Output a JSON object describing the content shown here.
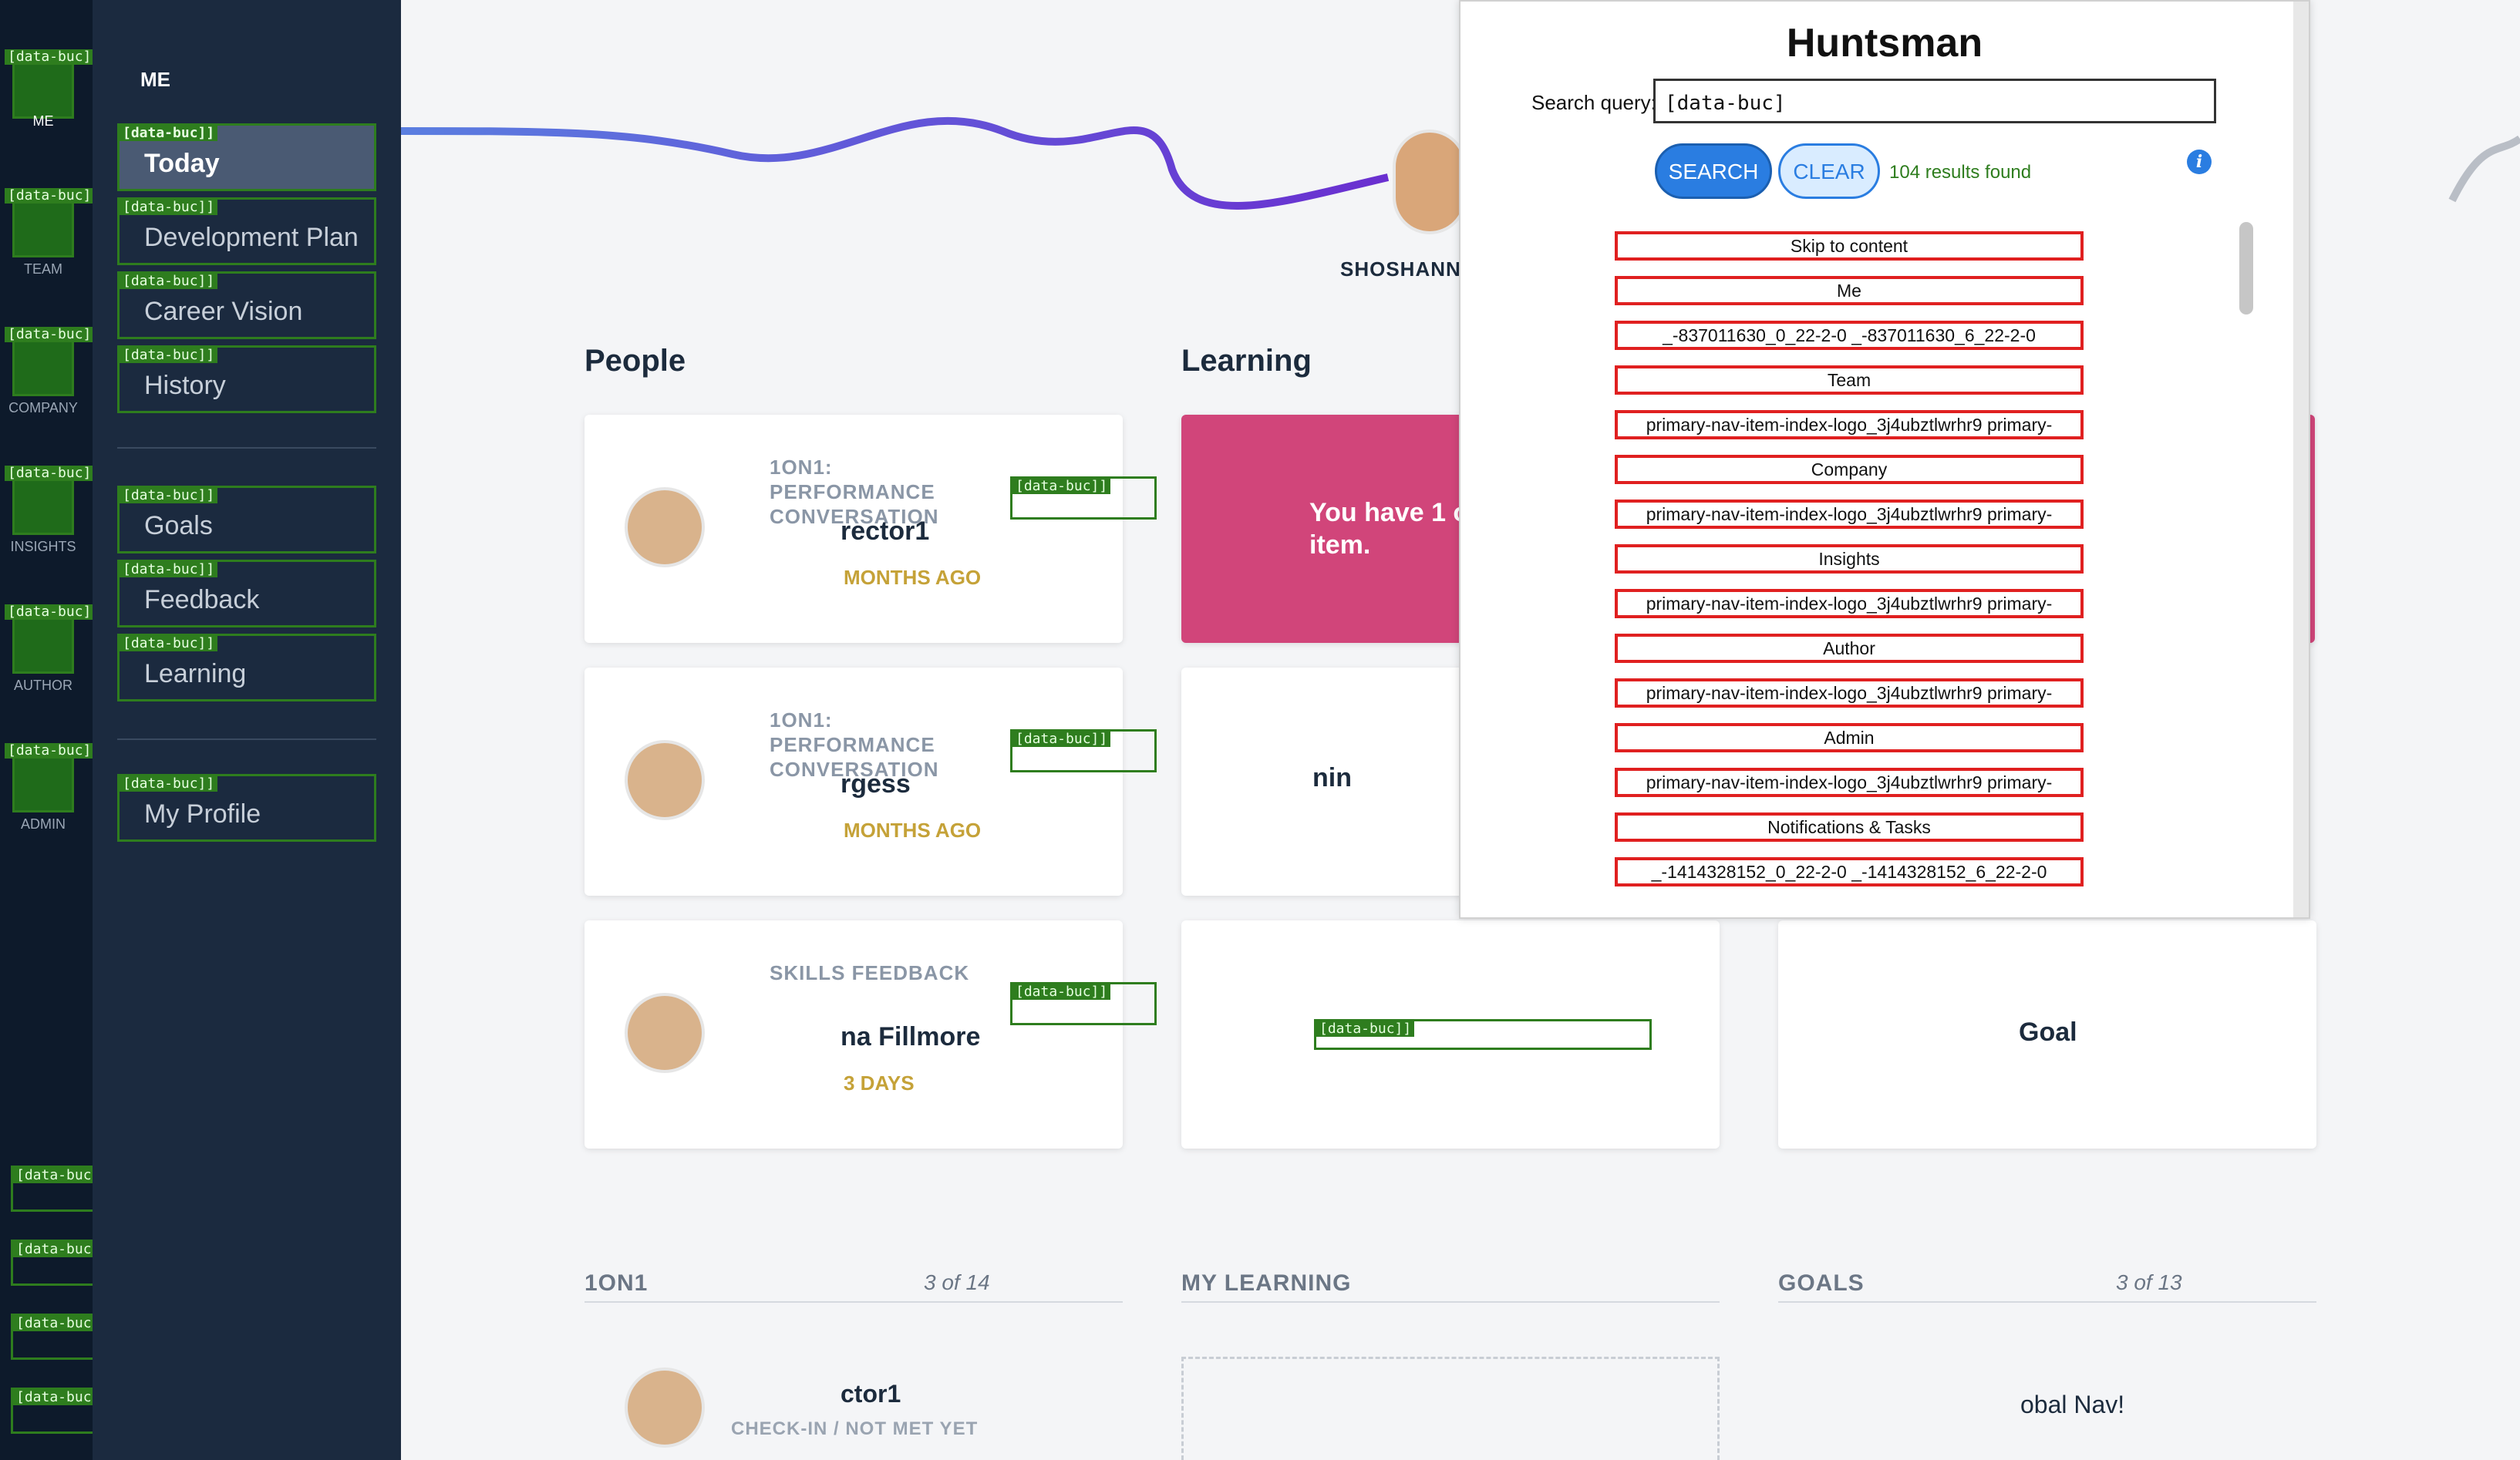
{
  "rail": {
    "items": [
      {
        "label": "ME",
        "tag": "[data-buc]"
      },
      {
        "label": "TEAM",
        "tag": "[data-buc]"
      },
      {
        "label": "COMPANY",
        "tag": "[data-buc]"
      },
      {
        "label": "INSIGHTS",
        "tag": "[data-buc]"
      },
      {
        "label": "AUTHOR",
        "tag": "[data-buc]"
      },
      {
        "label": "ADMIN",
        "tag": "[data-buc]"
      }
    ],
    "bottom_tags": [
      "[data-buc]",
      "[data-buc]",
      "[data-buc]",
      "[data-buc]"
    ]
  },
  "sidenav": {
    "heading": "ME",
    "items": [
      {
        "label": "Today",
        "tag": "[data-buc]]"
      },
      {
        "label": "Development Plan",
        "tag": "[data-buc]]"
      },
      {
        "label": "Career Vision",
        "tag": "[data-buc]]"
      },
      {
        "label": "History",
        "tag": "[data-buc]]"
      },
      {
        "label": "Goals",
        "tag": "[data-buc]]"
      },
      {
        "label": "Feedback",
        "tag": "[data-buc]]"
      },
      {
        "label": "Learning",
        "tag": "[data-buc]]"
      },
      {
        "label": "My Profile",
        "tag": "[data-buc]]"
      }
    ]
  },
  "main": {
    "path_user": "SHOSHANNA",
    "sections": {
      "people": "People",
      "learning": "Learning"
    },
    "people_cards": [
      {
        "kind": "1ON1: PERFORMANCE CONVERSATION",
        "name": "rector1",
        "when": "MONTHS AGO",
        "tag": "[data-buc]]"
      },
      {
        "kind": "1ON1: PERFORMANCE CONVERSATION",
        "name": "rgess",
        "when": "MONTHS AGO",
        "tag": "[data-buc]]"
      },
      {
        "kind": "SKILLS FEEDBACK",
        "name": "na Fillmore",
        "when": "3 DAYS",
        "tag": "[data-buc]]"
      }
    ],
    "learning_cards": [
      {
        "text": "You have 1 o\nitem."
      },
      {
        "text": "nin"
      },
      {
        "text": ""
      }
    ],
    "goal_card": {
      "name": "Goal"
    },
    "bottom": {
      "oneonone": {
        "title": "1ON1",
        "count": "3 of 14",
        "row_name": "ctor1",
        "row_status": "CHECK-IN / NOT MET YET"
      },
      "my_learning": {
        "title": "MY LEARNING"
      },
      "goals": {
        "title": "GOALS",
        "count": "3 of 13",
        "row_name": "obal Nav!"
      }
    },
    "tag": "[data-buc]]"
  },
  "huntsman": {
    "title": "Huntsman",
    "query_label": "Search query:",
    "query_value": "[data-buc]",
    "search_label": "SEARCH",
    "clear_label": "CLEAR",
    "result_count": "104 results found",
    "info": "i",
    "results": [
      "Skip to content",
      "Me",
      "_-837011630_0_22-2-0 _-837011630_6_22-2-0",
      "Team",
      "primary-nav-item-index-logo_3j4ubztlwrhr9 primary-",
      "Company",
      "primary-nav-item-index-logo_3j4ubztlwrhr9 primary-",
      "Insights",
      "primary-nav-item-index-logo_3j4ubztlwrhr9 primary-",
      "Author",
      "primary-nav-item-index-logo_3j4ubztlwrhr9 primary-",
      "Admin",
      "primary-nav-item-index-logo_3j4ubztlwrhr9 primary-",
      "Notifications & Tasks",
      "_-1414328152_0_22-2-0 _-1414328152_6_22-2-0"
    ]
  },
  "colors": {
    "rail": "#0d1a2b",
    "sidenav": "#1b2a3f",
    "accent": "#2a7de1",
    "highlight": "#2e7d1e",
    "pink": "#d1457a",
    "when": "#c5a238"
  }
}
